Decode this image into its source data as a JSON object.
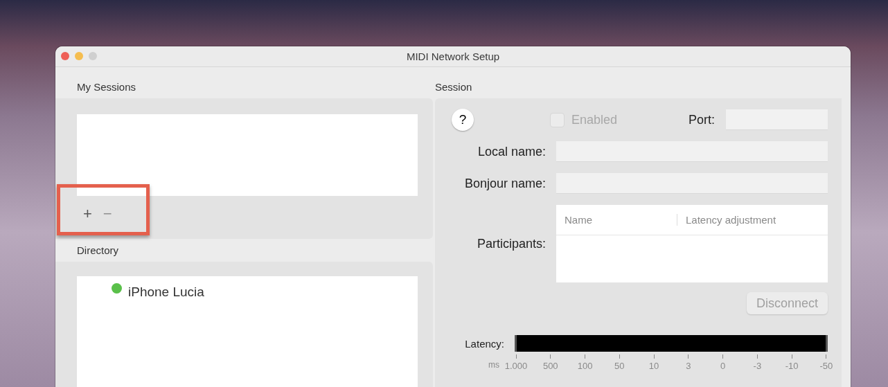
{
  "window": {
    "title": "MIDI Network Setup",
    "traffic_lights": [
      {
        "kind": "close",
        "disabled": false
      },
      {
        "kind": "minimize",
        "disabled": false
      },
      {
        "kind": "zoom",
        "disabled": true
      }
    ]
  },
  "my_sessions": {
    "title": "My Sessions",
    "buttons": [
      {
        "label": "+",
        "disabled": false
      },
      {
        "label": "−",
        "disabled": true
      }
    ],
    "highlighted": true
  },
  "directory": {
    "title": "Directory",
    "items": [
      {
        "name": "iPhone Lucia",
        "color": "#5ac04a"
      }
    ]
  },
  "session": {
    "title": "Session",
    "help": "?",
    "enabled": {
      "label": "Enabled",
      "checked": false,
      "disabled": true
    },
    "port_label": "Port:",
    "local_name_label": "Local name:",
    "bonjour_name_label": "Bonjour name:",
    "participants_label": "Participants:",
    "participants_columns": [
      "Name",
      "Latency adjustment"
    ],
    "disconnect": {
      "label": "Disconnect",
      "disabled": true
    },
    "latency_label": "Latency:",
    "latency_unit": "ms",
    "latency_scale": [
      "1.000",
      "500",
      "100",
      "50",
      "10",
      "3",
      "0",
      "-3",
      "-10",
      "-50"
    ]
  }
}
